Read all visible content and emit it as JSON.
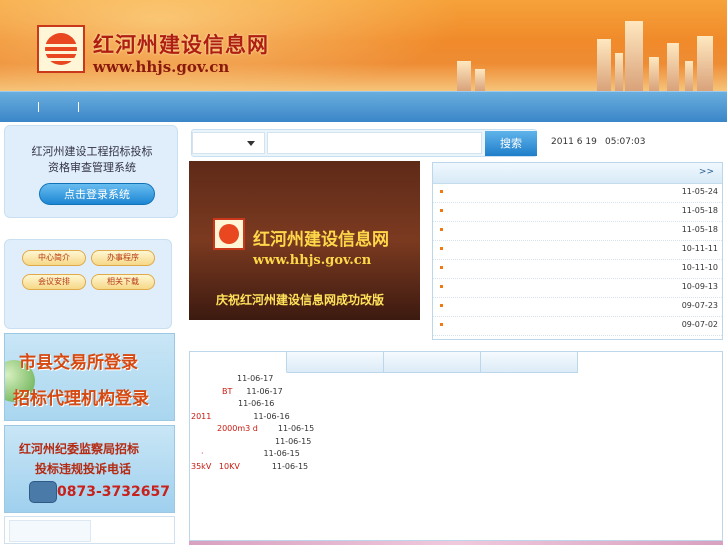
{
  "header": {
    "title": "红河州建设信息网",
    "url": "www.hhjs.gov.cn"
  },
  "login_panel": {
    "line1": "红河州建设工程招标投标",
    "line2": "资格审查管理系统",
    "button_label": "点击登录系统"
  },
  "menu": {
    "items": [
      "中心简介",
      "办事程序",
      "会议安排",
      "相关下载"
    ]
  },
  "promo1": {
    "line1": "市县交易所登录",
    "line2": "招标代理机构登录"
  },
  "promo2": {
    "line1": "红河州纪委监察局招标",
    "line2": "投标违规投诉电话",
    "phone": "0873-3732657"
  },
  "search": {
    "button_label": "搜索",
    "select_value": "",
    "input_value": ""
  },
  "datetime": {
    "date": "2011 6 19",
    "time": "05:07:03"
  },
  "feature": {
    "title": "红河州建设信息网",
    "url": "www.hhjs.gov.cn",
    "caption": "庆祝红河州建设信息网成功改版"
  },
  "news": {
    "more_label": ">>",
    "items": [
      {
        "date": "11-05-24"
      },
      {
        "date": "11-05-18"
      },
      {
        "date": "11-05-18"
      },
      {
        "date": "10-11-11"
      },
      {
        "date": "10-11-10"
      },
      {
        "date": "10-09-13"
      },
      {
        "date": "09-07-23"
      },
      {
        "date": "09-07-02"
      }
    ]
  },
  "tabs": {
    "labels": [
      "",
      "",
      "",
      ""
    ]
  },
  "list": {
    "items": [
      {
        "prefix": "",
        "date": "11-06-17"
      },
      {
        "prefix": "BT",
        "date": "11-06-17"
      },
      {
        "prefix": "",
        "date": "11-06-16"
      },
      {
        "prefix": "2011",
        "date": "11-06-16"
      },
      {
        "prefix": "2000m3 d",
        "date": "11-06-15"
      },
      {
        "prefix": "",
        "date": "11-06-15"
      },
      {
        "prefix": "·",
        "date": "11-06-15"
      },
      {
        "prefix": "35kV   10KV",
        "date": "11-06-15"
      }
    ]
  },
  "colors": {
    "header_orange": "#f08a2a",
    "nav_blue": "#3a86c8",
    "accent_red": "#c81a10",
    "button_blue": "#1f7ec9"
  }
}
